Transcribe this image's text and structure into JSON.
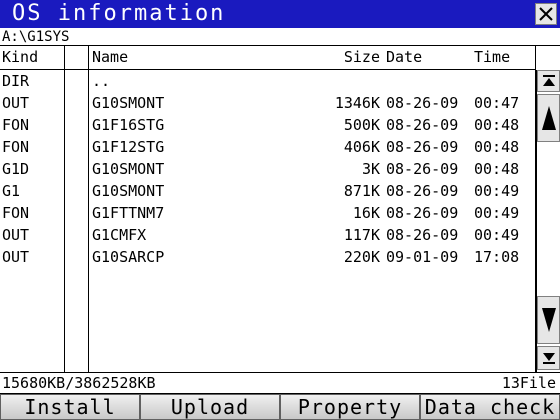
{
  "window": {
    "title": "OS information",
    "close_label": "close"
  },
  "path": "A:\\G1SYS",
  "columns": {
    "kind": "Kind",
    "name": "Name",
    "size": "Size",
    "date": "Date",
    "time": "Time"
  },
  "rows": [
    {
      "kind": "DIR",
      "name": "..",
      "size": "",
      "date": "",
      "time": ""
    },
    {
      "kind": "OUT",
      "name": "G10SMONT",
      "size": "1346K",
      "date": "08-26-09",
      "time": "00:47"
    },
    {
      "kind": "FON",
      "name": "G1F16STG",
      "size": "500K",
      "date": "08-26-09",
      "time": "00:48"
    },
    {
      "kind": "FON",
      "name": "G1F12STG",
      "size": "406K",
      "date": "08-26-09",
      "time": "00:48"
    },
    {
      "kind": "G1D",
      "name": "G10SMONT",
      "size": "3K",
      "date": "08-26-09",
      "time": "00:48"
    },
    {
      "kind": "G1",
      "name": "G10SMONT",
      "size": "871K",
      "date": "08-26-09",
      "time": "00:49"
    },
    {
      "kind": "FON",
      "name": "G1FTTNM7",
      "size": "16K",
      "date": "08-26-09",
      "time": "00:49"
    },
    {
      "kind": "OUT",
      "name": "G1CMFX",
      "size": "117K",
      "date": "08-26-09",
      "time": "00:49"
    },
    {
      "kind": "OUT",
      "name": "G10SARCP",
      "size": "220K",
      "date": "09-01-09",
      "time": "17:08"
    }
  ],
  "status": {
    "capacity": "15680KB/3862528KB",
    "file_count": "13File"
  },
  "buttons": {
    "install": "Install",
    "upload": "Upload",
    "property": "Property",
    "data_check": "Data check"
  },
  "icons": {
    "close": "close-x-icon",
    "scroll_top": "scroll-top-icon",
    "page_up": "page-up-icon",
    "page_down": "page-down-icon",
    "scroll_bottom": "scroll-bottom-icon"
  },
  "colors": {
    "titlebar": "#1a1abf",
    "titletext": "#ffffff",
    "background": "#ffffff"
  }
}
